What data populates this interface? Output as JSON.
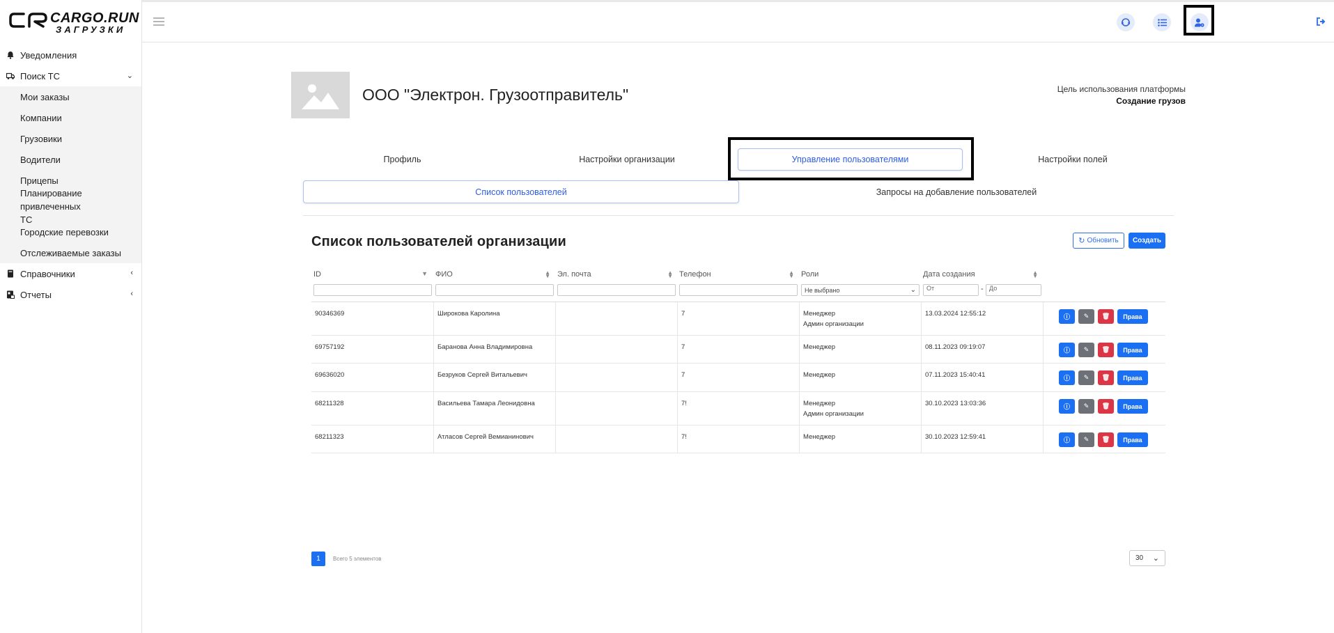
{
  "logo": {
    "main": "CARGO.RUN",
    "sub": "ЗАГРУЗКИ"
  },
  "sidebar": {
    "items": [
      {
        "label": "Уведомления",
        "icon": "bell-icon"
      },
      {
        "label": "Поиск ТС",
        "icon": "truck-icon",
        "expanded": true,
        "children": [
          "Мои заказы",
          "Компании",
          "Грузовики",
          "Водители",
          "Прицепы",
          "Планирование привлеченных ТС",
          "Городские перевозки",
          "Отслеживаемые заказы"
        ]
      },
      {
        "label": "Справочники",
        "icon": "book-icon"
      },
      {
        "label": "Отчеты",
        "icon": "report-icon"
      }
    ]
  },
  "topbar": {
    "icons": [
      "support-icon",
      "list-icon",
      "user-settings-icon",
      "logout-icon"
    ]
  },
  "org": {
    "name": "ООО \"Электрон. Грузоотправитель\"",
    "purpose_label": "Цель использования платформы",
    "purpose_value": "Создание грузов"
  },
  "tabs": [
    "Профиль",
    "Настройки организации",
    "Управление пользователями",
    "Настройки полей"
  ],
  "active_tab": "Управление пользователями",
  "subtabs": [
    "Список пользователей",
    "Запросы на добавление пользователей"
  ],
  "active_subtab": "Список пользователей",
  "list": {
    "title": "Список пользователей организации",
    "refresh_label": "Обновить",
    "create_label": "Создать",
    "columns": [
      "ID",
      "ФИО",
      "Эл. почта",
      "Телефон",
      "Роли",
      "Дата создания"
    ],
    "roles_filter": "Не выбрано",
    "date_from_placeholder": "От",
    "date_to_placeholder": "До",
    "rights_label": "Права",
    "rows": [
      {
        "id": "90346369",
        "name": "Широкова Каролина",
        "email": "",
        "phone": "7",
        "roles": [
          "Менеджер",
          "Админ организации"
        ],
        "created": "13.03.2024 12:55:12"
      },
      {
        "id": "69757192",
        "name": "Баранова Анна Владимировна",
        "email": "",
        "phone": "7",
        "roles": [
          "Менеджер"
        ],
        "created": "08.11.2023 09:19:07"
      },
      {
        "id": "69636020",
        "name": "Безруков Сергей Витальевич",
        "email": "",
        "phone": "7",
        "roles": [
          "Менеджер"
        ],
        "created": "07.11.2023 15:40:41"
      },
      {
        "id": "68211328",
        "name": "Васильева Тамара Леонидовна",
        "email": "",
        "phone": "7!",
        "roles": [
          "Менеджер",
          "Админ организации"
        ],
        "created": "30.10.2023 13:03:36"
      },
      {
        "id": "68211323",
        "name": "Атласов Сергей Вемианинович",
        "email": "",
        "phone": "7!",
        "roles": [
          "Менеджер"
        ],
        "created": "30.10.2023 12:59:41"
      }
    ]
  },
  "pagination": {
    "current_page": "1",
    "total": "Всего 5 элементов",
    "per_page": "30"
  },
  "colors": {
    "primary": "#1a6ff2",
    "danger": "#dc3545",
    "secondary": "#6d7177",
    "active_text": "#2e5ee0"
  }
}
